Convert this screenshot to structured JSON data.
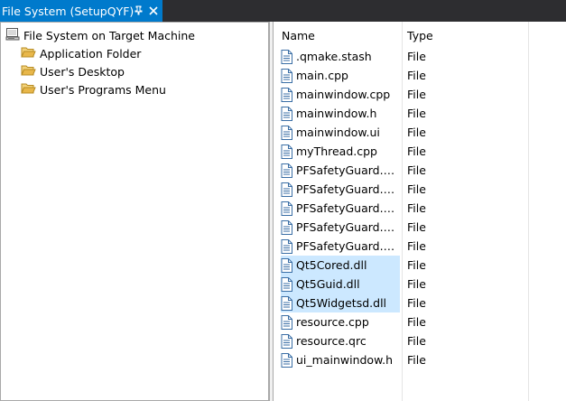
{
  "tab": {
    "title": "File System (SetupQYF)"
  },
  "tree": {
    "root": "File System on Target Machine",
    "children": [
      {
        "label": "Application Folder"
      },
      {
        "label": "User's Desktop"
      },
      {
        "label": "User's Programs Menu"
      }
    ]
  },
  "list": {
    "columns": {
      "name": "Name",
      "type": "Type"
    },
    "rows": [
      {
        "name": ".qmake.stash",
        "type": "File"
      },
      {
        "name": "main.cpp",
        "type": "File"
      },
      {
        "name": "mainwindow.cpp",
        "type": "File"
      },
      {
        "name": "mainwindow.h",
        "type": "File"
      },
      {
        "name": "mainwindow.ui",
        "type": "File"
      },
      {
        "name": "myThread.cpp",
        "type": "File"
      },
      {
        "name": "PFSafetyGuard.pro",
        "type": "File"
      },
      {
        "name": "PFSafetyGuard.sln",
        "type": "File"
      },
      {
        "name": "PFSafetyGuard.vcx...",
        "type": "File"
      },
      {
        "name": "PFSafetyGuard.vcx...",
        "type": "File"
      },
      {
        "name": "PFSafetyGuard.vcx...",
        "type": "File"
      },
      {
        "name": "Qt5Cored.dll",
        "type": "File",
        "selected": true
      },
      {
        "name": "Qt5Guid.dll",
        "type": "File",
        "selected": true
      },
      {
        "name": "Qt5Widgetsd.dll",
        "type": "File",
        "selected": true
      },
      {
        "name": "resource.cpp",
        "type": "File"
      },
      {
        "name": "resource.qrc",
        "type": "File"
      },
      {
        "name": "ui_mainwindow.h",
        "type": "File"
      }
    ]
  },
  "colors": {
    "accent": "#007acc",
    "selection": "#cce8ff",
    "folder": "#e8b74a"
  }
}
